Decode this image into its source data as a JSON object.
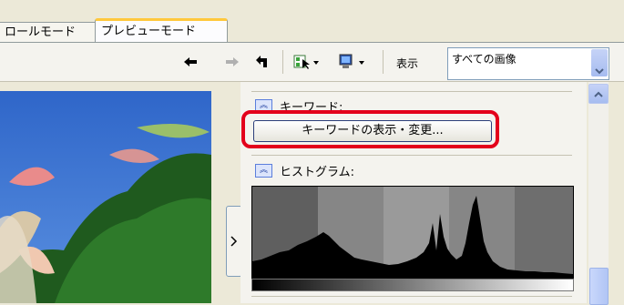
{
  "tabs": [
    {
      "label": "ロールモード"
    },
    {
      "label": "プレビューモード"
    }
  ],
  "toolbar": {
    "back_icon": "←",
    "forward_icon": "→",
    "up_icon": "⮤",
    "view_icon": "view-select-icon",
    "monitor_icon": "monitor-icon",
    "display_label": "表示"
  },
  "filter": {
    "selected": "すべての画像"
  },
  "keyword": {
    "header": "キーワード:",
    "button": "キーワードの表示・変更..."
  },
  "histogram": {
    "header": "ヒストグラム:"
  },
  "colors": {
    "highlight": "#e3001b",
    "tab_accent": "#ffc83c"
  }
}
